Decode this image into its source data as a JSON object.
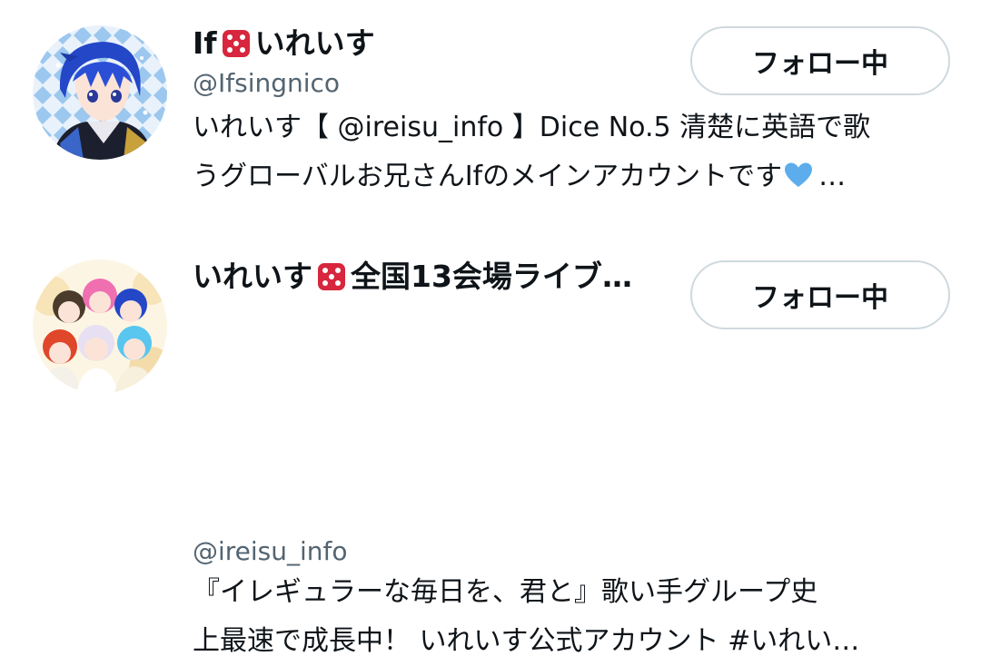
{
  "colors": {
    "text_primary": "#0f1419",
    "text_secondary": "#536471",
    "button_border": "#cfd9de",
    "dice_red": "#d7263d",
    "heart_blue": "#5dadec"
  },
  "users": [
    {
      "name": "If",
      "name_suffix": "いれいす",
      "name_icon": "game-die-icon",
      "handle": "@Ifsingnico",
      "follow_label": "フォロー中",
      "bio_line1": "いれいす【 @ireisu_info 】Dice No.5 清楚に英語で歌",
      "bio_line2": "うグローバルお兄さんIfのメインアカウントです",
      "bio_line2_icon": "blue-heart-icon",
      "bio_line2_ellipsis": "…"
    },
    {
      "name": "いれいす",
      "name_suffix": "全国13会場ライブ開…",
      "name_icon": "game-die-icon",
      "handle": "@ireisu_info",
      "follow_label": "フォロー中",
      "bio_line1": "『イレギュラーな毎日を、君と』歌い手グループ史",
      "bio_line2": "上最速で成長中！ いれいす公式アカウント #いれい…"
    }
  ]
}
